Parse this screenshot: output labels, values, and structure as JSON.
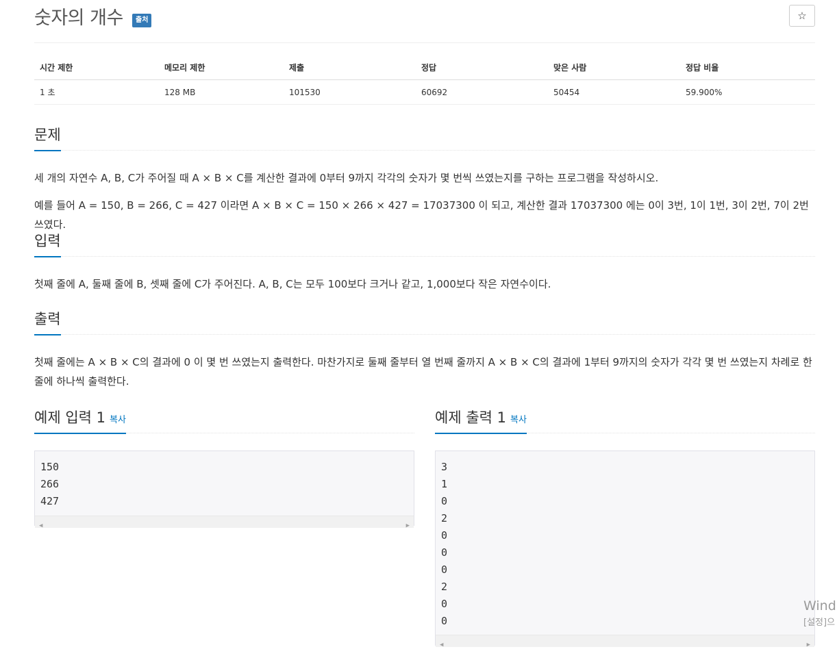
{
  "problem": {
    "title": "숫자의 개수",
    "badge": "출처",
    "star_icon": "☆"
  },
  "info_table": {
    "headers": [
      "시간 제한",
      "메모리 제한",
      "제출",
      "정답",
      "맞은 사람",
      "정답 비율"
    ],
    "values": [
      "1 초",
      "128 MB",
      "101530",
      "60692",
      "50454",
      "59.900%"
    ]
  },
  "sections": {
    "description": {
      "heading": "문제",
      "paragraphs": [
        "세 개의 자연수 A, B, C가 주어질 때 A × B × C를 계산한 결과에 0부터 9까지 각각의 숫자가 몇 번씩 쓰였는지를 구하는 프로그램을 작성하시오.",
        "예를 들어 A = 150, B = 266, C = 427 이라면 A × B × C = 150 × 266 × 427 = 17037300 이 되고, 계산한 결과 17037300 에는 0이 3번, 1이 1번, 3이 2번, 7이 2번 쓰였다."
      ]
    },
    "input": {
      "heading": "입력",
      "paragraphs": [
        "첫째 줄에 A, 둘째 줄에 B, 셋째 줄에 C가 주어진다. A, B, C는 모두 100보다 크거나 같고, 1,000보다 작은 자연수이다."
      ]
    },
    "output": {
      "heading": "출력",
      "paragraphs": [
        "첫째 줄에는 A × B × C의 결과에 0 이 몇 번 쓰였는지 출력한다. 마찬가지로 둘째 줄부터 열 번째 줄까지 A × B × C의 결과에 1부터 9까지의 숫자가 각각 몇 번 쓰였는지 차례로 한 줄에 하나씩 출력한다."
      ]
    }
  },
  "samples": {
    "input": {
      "heading": "예제 입력 1",
      "copy_label": "복사",
      "lines": [
        "150",
        "266",
        "427"
      ]
    },
    "output": {
      "heading": "예제 출력 1",
      "copy_label": "복사",
      "lines": [
        "3",
        "1",
        "0",
        "2",
        "0",
        "0",
        "0",
        "2",
        "0",
        "0"
      ]
    }
  },
  "watermark": {
    "line1": "Wind",
    "line2": "[설정]으"
  }
}
